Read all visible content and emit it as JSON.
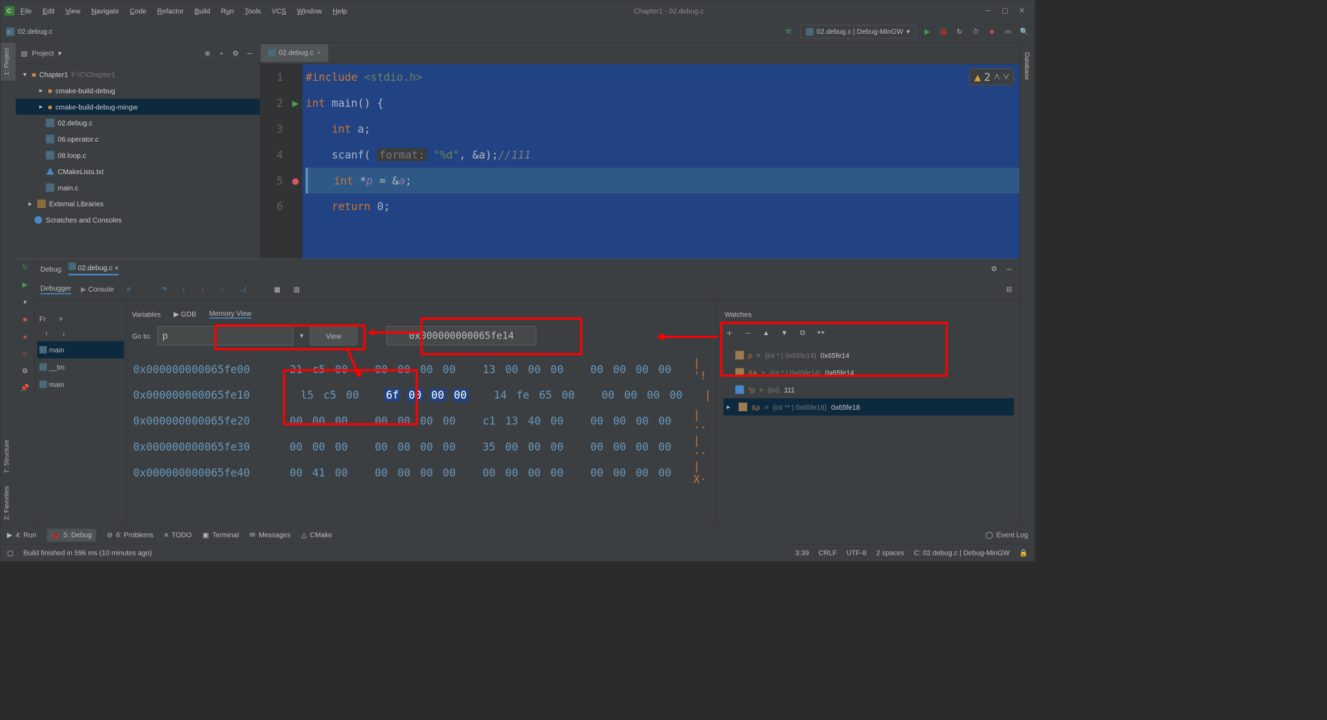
{
  "menu": {
    "file": "File",
    "edit": "Edit",
    "view": "View",
    "navigate": "Navigate",
    "code": "Code",
    "refactor": "Refactor",
    "build": "Build",
    "run": "Run",
    "tools": "Tools",
    "vcs": "VCS",
    "window": "Window",
    "help": "Help"
  },
  "window_title": "Chapter1 - 02.debug.c",
  "breadcrumb": {
    "file": "02.debug.c"
  },
  "run_config": "02.debug.c | Debug-MinGW",
  "project_panel": {
    "title": "Project",
    "root_name": "Chapter1",
    "root_path": "F:\\C\\Chapter1",
    "items": [
      {
        "type": "folder",
        "label": "cmake-build-debug",
        "indent": 2
      },
      {
        "type": "folder",
        "label": "cmake-build-debug-mingw",
        "indent": 2,
        "selected": true
      },
      {
        "type": "c",
        "label": "02.debug.c",
        "indent": 2
      },
      {
        "type": "c",
        "label": "06.operator.c",
        "indent": 2
      },
      {
        "type": "c",
        "label": "08.loop.c",
        "indent": 2
      },
      {
        "type": "cmake",
        "label": "CMakeLists.txt",
        "indent": 2
      },
      {
        "type": "c",
        "label": "main.c",
        "indent": 2
      }
    ],
    "ext_lib": "External Libraries",
    "scratches": "Scratches and Consoles"
  },
  "editor": {
    "tab": "02.debug.c",
    "warn_count": "2",
    "lines": {
      "l1": "#include <stdio.h>",
      "l2": "int main() {",
      "l3": "    int a;",
      "l4_a": "    scanf(",
      "l4_hint": "format:",
      "l4_b": " \"%d\", &a);",
      "l4_c": "//111",
      "l5": "    int *p = &a;",
      "l6": "    return 0;"
    }
  },
  "debug": {
    "title": "Debug:",
    "target": "02.debug.c",
    "tab_debugger": "Debugger",
    "tab_console": "Console",
    "frames_label": "Fr",
    "variables_label": "Variables",
    "gdb_label": "GDB",
    "memview_label": "Memory View",
    "goto_label": "Go to:",
    "goto_value": "p",
    "view_label": "View",
    "address": "0x000000000065fe14",
    "frames": [
      "main",
      "__tm",
      "main"
    ],
    "memory": [
      {
        "addr": "0x000000000065fe00",
        "bytes": [
          "21",
          "c5",
          "00",
          "00",
          "00",
          "00",
          "00",
          "13",
          "00",
          "00",
          "00",
          "00",
          "00",
          "00",
          "00"
        ],
        "asc": "'!"
      },
      {
        "addr": "0x000000000065fe10",
        "bytes": [
          "l5",
          "c5",
          "00",
          "6f",
          "00",
          "00",
          "00",
          "14",
          "fe",
          "65",
          "00",
          "00",
          "00",
          "00",
          "00"
        ],
        "asc": "",
        "hilite": [
          3,
          4,
          5,
          6
        ]
      },
      {
        "addr": "0x000000000065fe20",
        "bytes": [
          "00",
          "00",
          "00",
          "00",
          "00",
          "00",
          "00",
          "c1",
          "13",
          "40",
          "00",
          "00",
          "00",
          "00",
          "00"
        ],
        "asc": "··"
      },
      {
        "addr": "0x000000000065fe30",
        "bytes": [
          "00",
          "00",
          "00",
          "00",
          "00",
          "00",
          "00",
          "35",
          "00",
          "00",
          "00",
          "00",
          "00",
          "00",
          "00"
        ],
        "asc": "··"
      },
      {
        "addr": "0x000000000065fe40",
        "bytes": [
          "00",
          "41",
          "00",
          "00",
          "00",
          "00",
          "00",
          "00",
          "00",
          "00",
          "00",
          "00",
          "00",
          "00",
          "00"
        ],
        "asc": "X·"
      }
    ],
    "watches_label": "Watches",
    "watches": [
      {
        "name": "p",
        "type": "{int * | 0x65fe14}",
        "val": "0x65fe14"
      },
      {
        "name": "&a",
        "type": "{int * | 0x65fe14}",
        "val": "0x65fe14"
      },
      {
        "name": "*p",
        "type": "{int}",
        "val": "111",
        "icon": "bin"
      },
      {
        "name": "&p",
        "type": "{int ** | 0x65fe18}",
        "val": "0x65fe18",
        "sel": true,
        "arrow": true
      }
    ]
  },
  "bottom": {
    "run": "4: Run",
    "debug": "5: Debug",
    "problems": "6: Problems",
    "todo": "TODO",
    "terminal": "Terminal",
    "messages": "Messages",
    "cmake": "CMake",
    "eventlog": "Event Log"
  },
  "status": {
    "build": "Build finished in 596 ms (10 minutes ago)",
    "pos": "3:39",
    "crlf": "CRLF",
    "enc": "UTF-8",
    "indent": "2 spaces",
    "ctx": "C: 02.debug.c | Debug-MinGW"
  },
  "side": {
    "project": "1: Project",
    "structure": "7: Structure",
    "favorites": "2: Favorites",
    "database": "Database"
  }
}
